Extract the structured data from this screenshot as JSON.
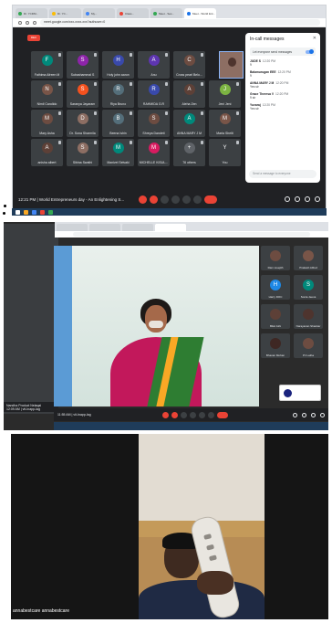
{
  "panel1": {
    "tabs": [
      {
        "label": "Dr. YCDM...",
        "color": "#34a853"
      },
      {
        "label": "Dr. YC...",
        "color": "#fbbc04"
      },
      {
        "label": "My...",
        "color": "#4285f4"
      },
      {
        "label": "Class...",
        "color": "#ea4335"
      },
      {
        "label": "Meet - Ses...",
        "color": "#34a853"
      },
      {
        "label": "Meet - World Ent...",
        "color": "#1a73e8",
        "active": true
      }
    ],
    "url": "meet.google.com/xxx-xxxx-xxx?authuser=0",
    "rec_label": "REC",
    "participants": [
      {
        "name": "Fathima Afreen M",
        "initial": "F",
        "color": "#00897b"
      },
      {
        "name": "Subashammal S",
        "initial": "S",
        "color": "#8e24aa"
      },
      {
        "name": "Holy john aaron",
        "initial": "H",
        "color": "#3949ab"
      },
      {
        "name": "Anu",
        "initial": "A",
        "color": "#5e35b1"
      },
      {
        "name": "Cross pearl Belo...",
        "initial": "C",
        "color": "#6d4c41"
      },
      {
        "name": "Nithi Vinoda",
        "initial": "N",
        "color": "#00897b"
      },
      {
        "name": "Nimil Candido",
        "initial": "N",
        "color": "#795548"
      },
      {
        "name": "Saranya Jayaram",
        "initial": "S",
        "color": "#f4511e"
      },
      {
        "name": "Riya Bruno",
        "initial": "R",
        "color": "#546e7a"
      },
      {
        "name": "RAHMIDA G.R",
        "initial": "R",
        "color": "#3949ab"
      },
      {
        "name": "Aleha Zen",
        "initial": "A",
        "color": "#5d4037"
      },
      {
        "name": "Jeni Jeni",
        "initial": "J",
        "color": "#7cb342"
      },
      {
        "name": "Mary Asha",
        "initial": "M",
        "color": "#6d4c41"
      },
      {
        "name": "Dr. Sona Sharmila",
        "initial": "D",
        "color": "#8d6e63"
      },
      {
        "name": "Beena Ishin",
        "initial": "B",
        "color": "#546e7a"
      },
      {
        "name": "Shreya Dandeti",
        "initial": "S",
        "color": "#6d4c41"
      },
      {
        "name": "ANNA MARY J M",
        "initial": "A",
        "color": "#00897b"
      },
      {
        "name": "Maria Shelti",
        "initial": "M",
        "color": "#795548"
      },
      {
        "name": "anisha albert",
        "initial": "A",
        "color": "#5d4037"
      },
      {
        "name": "Sibina Swathi",
        "initial": "S",
        "color": "#8d6e63"
      },
      {
        "name": "Manivel Selvaki",
        "initial": "M",
        "color": "#00897b"
      },
      {
        "name": "MICHELLE KISUL...",
        "initial": "M",
        "color": "#d81b60"
      },
      {
        "name": "76 others",
        "initial": "+",
        "color": "#5f6368"
      },
      {
        "name": "You",
        "initial": "Y",
        "color": "#3c4043"
      }
    ],
    "chat": {
      "title": "In-call messages",
      "close": "✕",
      "toggle_label": "Let everyone send messages",
      "messages": [
        {
          "who": "JUDE S",
          "time": "12:20 PM",
          "text": "9"
        },
        {
          "who": "Balamurugan EEE",
          "time": "12:20 PM",
          "text": "9"
        },
        {
          "who": "ANNA MARY J M",
          "time": "12:20 PM",
          "text": "Yes sir"
        },
        {
          "who": "Grace Theresa V",
          "time": "12:20 PM",
          "text": "9 sir"
        },
        {
          "who": "Yuvaraj",
          "time": "12:20 PM",
          "text": "Yes sir"
        }
      ],
      "send_placeholder": "Send a message to everyone"
    },
    "bottom_bar": {
      "time_title": "12:21 PM | World Entrepreneurs day - An Enlightening S..."
    }
  },
  "panel2": {
    "back_window_label": "Nandha Product Nelaqal",
    "back_window_time": "12:09 AM | vit-Inapp-lag",
    "bottom_bar": {
      "time_title": "11:55 AM | vit-Inapp-lag"
    },
    "sidebar": [
      {
        "name": "Ram sreejith",
        "initial": "",
        "color": "#6d4c41"
      },
      {
        "name": "Prakash Alfred",
        "initial": "",
        "color": "#795548"
      },
      {
        "name": "Harry DOC",
        "initial": "H",
        "color": "#1e88e5"
      },
      {
        "name": "Sonia Jeeva",
        "initial": "S",
        "color": "#00897b"
      },
      {
        "name": "Bilal Juhi",
        "initial": "",
        "color": "#5d4037"
      },
      {
        "name": "Narayanan Shankar",
        "initial": "",
        "color": "#4e342e"
      },
      {
        "name": "Bhavan Mohan",
        "initial": "",
        "color": "#3e2723"
      },
      {
        "name": "Pri Latha",
        "initial": "",
        "color": "#6d4c41"
      }
    ]
  },
  "panel3": {
    "participant_name": "annabestcare annabestcare"
  }
}
